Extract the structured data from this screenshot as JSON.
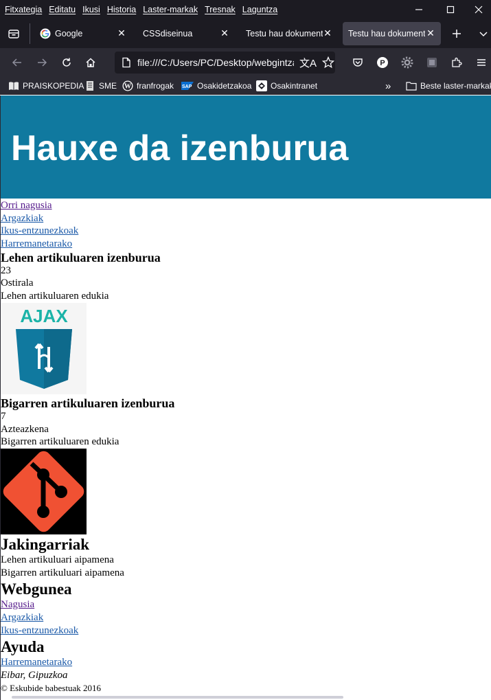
{
  "menubar": {
    "items": [
      "Fitxategia",
      "Editatu",
      "Ikusi",
      "Historia",
      "Laster-markak",
      "Tresnak",
      "Laguntza"
    ]
  },
  "tabs": [
    {
      "title": "Google",
      "active": false
    },
    {
      "title": "CSSdiseinua",
      "active": false
    },
    {
      "title": "Testu hau dokumentu",
      "active": false
    },
    {
      "title": "Testu hau dokumentu",
      "active": true
    }
  ],
  "urlbar": {
    "value": "file:///C:/Users/PC/Desktop/webgintza"
  },
  "bookmarks": {
    "items": [
      "PRAISKOPEDIA",
      "SME",
      "franfrogak",
      "Osakidetzakoa",
      "Osakintranet"
    ],
    "more_label": "Beste laster-markak"
  },
  "page": {
    "header_title": "Hauxe da izenburua",
    "nav": [
      "Orri nagusia",
      "Argazkiak",
      "Ikus-entzunezkoak",
      "Harremanetarako"
    ],
    "articles": [
      {
        "title": "Lehen artikuluaren izenburua",
        "day": "23",
        "weekday": "Ostirala",
        "content": "Lehen artikuluaren edukia",
        "image": "AJAX"
      },
      {
        "title": "Bigarren artikuluaren izenburua",
        "day": "7",
        "weekday": "Azteazkena",
        "content": "Bigarren artikuluaren edukia",
        "image": "git-logo"
      }
    ],
    "aside": {
      "title": "Jakingarriak",
      "items": [
        "Lehen artikuluari aipamena",
        "Bigarren artikuluari aipamena"
      ]
    },
    "footer": {
      "website_title": "Webgunea",
      "website_links": [
        "Nagusia",
        "Argazkiak",
        "Ikus-entzunezkoak"
      ],
      "help_title": "Ayuda",
      "help_links": [
        "Harremanetarako"
      ],
      "address": "Eibar, Gipuzkoa",
      "copyright": "© Eskubide babestuak 2016"
    }
  },
  "colors": {
    "chrome_dark": "#1c1b22",
    "chrome_mid": "#2b2a33",
    "header_bg": "#10799f",
    "link": "#1a59a8",
    "visited": "#551a8b",
    "ajax_teal": "#1bb3a8",
    "ajax_blue": "#10799f",
    "git_orange": "#f05133"
  }
}
